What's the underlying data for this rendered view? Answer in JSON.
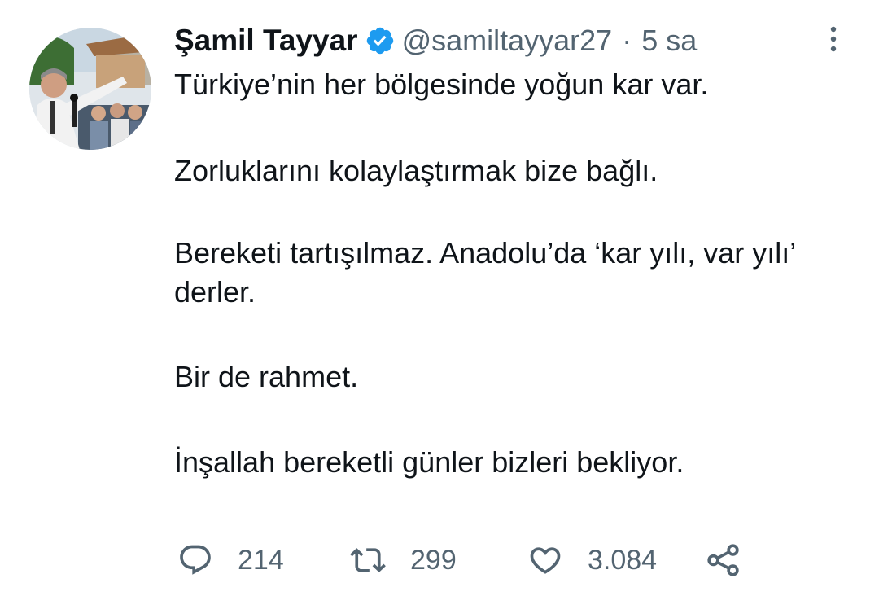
{
  "author": {
    "name": "Şamil Tayyar",
    "handle": "@samiltayyar27",
    "separator": "·",
    "time": "5 sa",
    "verified": true
  },
  "tweet": {
    "paragraphs": [
      "Türkiye’nin her bölgesinde yoğun kar var.",
      "Zorluklarını kolaylaştırmak bize bağlı.",
      "Bereketi tartışılmaz. Anadolu’da ‘kar yılı, var yılı’ derler.",
      "Bir de rahmet.",
      "İnşallah bereketli günler bizleri bekliyor."
    ]
  },
  "actions": {
    "reply": {
      "count": "214",
      "icon": "reply-icon"
    },
    "retweet": {
      "count": "299",
      "icon": "retweet-icon"
    },
    "like": {
      "count": "3.084",
      "icon": "heart-icon"
    },
    "share": {
      "icon": "share-icon"
    }
  },
  "colors": {
    "text_primary": "#0f1419",
    "text_secondary": "#536471",
    "verified": "#1d9bf0",
    "background": "#ffffff"
  }
}
